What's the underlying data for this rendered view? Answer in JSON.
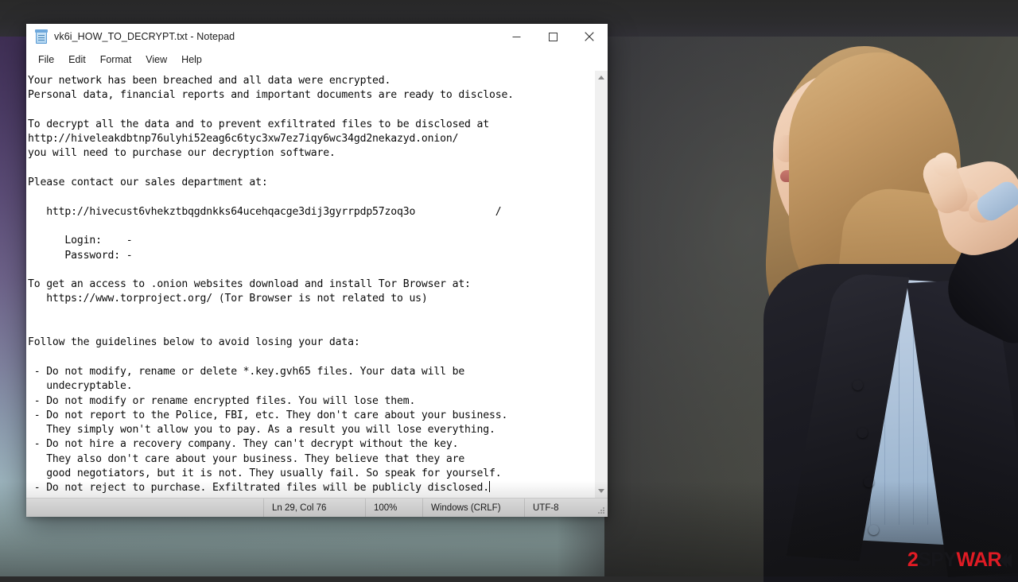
{
  "window": {
    "title": "vk6i_HOW_TO_DECRYPT.txt - Notepad",
    "icon": "notepad-icon",
    "controls": {
      "minimize": "Minimize",
      "maximize": "Maximize",
      "close": "Close"
    }
  },
  "menubar": {
    "items": [
      {
        "label": "File"
      },
      {
        "label": "Edit"
      },
      {
        "label": "Format"
      },
      {
        "label": "View"
      },
      {
        "label": "Help"
      }
    ]
  },
  "document": {
    "lines": [
      "Your network has been breached and all data were encrypted.",
      "Personal data, financial reports and important documents are ready to disclose.",
      "",
      "To decrypt all the data and to prevent exfiltrated files to be disclosed at",
      "http://hiveleakdbtnp76ulyhi52eag6c6tyc3xw7ez7iqy6wc34gd2nekazyd.onion/",
      "you will need to purchase our decryption software.",
      "",
      "Please contact our sales department at:",
      "",
      "   http://hivecust6vhekztbqgdnkks64ucehqacge3dij3gyrrpdp57zoq3o             /",
      "",
      "      Login:    -",
      "      Password: -",
      "",
      "To get an access to .onion websites download and install Tor Browser at:",
      "   https://www.torproject.org/ (Tor Browser is not related to us)",
      "",
      "",
      "Follow the guidelines below to avoid losing your data:",
      "",
      " - Do not modify, rename or delete *.key.gvh65 files. Your data will be",
      "   undecryptable.",
      " - Do not modify or rename encrypted files. You will lose them.",
      " - Do not report to the Police, FBI, etc. They don't care about your business.",
      "   They simply won't allow you to pay. As a result you will lose everything.",
      " - Do not hire a recovery company. They can't decrypt without the key.",
      "   They also don't care about your business. They believe that they are",
      "   good negotiators, but it is not. They usually fail. So speak for yourself.",
      " - Do not reject to purchase. Exfiltrated files will be publicly disclosed."
    ]
  },
  "statusbar": {
    "position": "Ln 29, Col 76",
    "zoom": "100%",
    "line_ending": "Windows (CRLF)",
    "encoding": "UTF-8"
  },
  "scrollbar": {
    "up_arrow": "scroll-up",
    "down_arrow": "scroll-down"
  },
  "watermark": {
    "part1": "2",
    "part2": "SPY",
    "part3": "WAR",
    "part4": "E"
  },
  "colors": {
    "accent_red": "#e01b24",
    "window_bg": "#ffffff",
    "statusbar_bg": "#f0f0f0",
    "text": "#0a0a0a",
    "backdrop_purple": "#4a3a63",
    "backdrop_teal": "#b7d5d2",
    "backdrop_gray": "#43443f"
  }
}
